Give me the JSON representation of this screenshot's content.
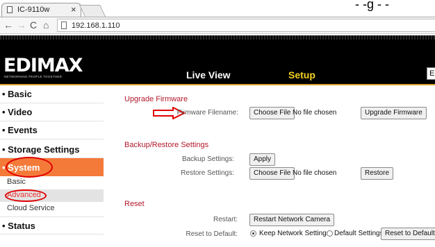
{
  "browser": {
    "tab_title": "IC-9110w",
    "tab_close": "×",
    "url": "192.168.1.110",
    "stray_text": "- -g - -"
  },
  "header": {
    "logo_text": "EDIMAX",
    "logo_tagline": "NETWORKING PEOPLE TOGETHER",
    "nav_live_view": "Live View",
    "nav_setup": "Setup",
    "language_value": "E"
  },
  "sidebar": {
    "basic": "• Basic",
    "video": "• Video",
    "events": "• Events",
    "storage": "• Storage Settings",
    "system": "• System",
    "system_sub": {
      "basic": "Basic",
      "advanced": "Advanced",
      "cloud": "Cloud Service"
    },
    "status": "• Status"
  },
  "upgrade": {
    "title": "Upgrade Firmware",
    "filename_label": "Firmware Filename:",
    "choose_file": "Choose File",
    "no_file": "No file chosen",
    "upgrade_button": "Upgrade Firmware"
  },
  "backup": {
    "title": "Backup/Restore Settings",
    "backup_label": "Backup Settings:",
    "apply_button": "Apply",
    "restore_label": "Restore Settings:",
    "choose_file": "Choose File",
    "no_file": "No file chosen",
    "restore_button": "Restore"
  },
  "reset": {
    "title": "Reset",
    "restart_label": "Restart:",
    "restart_button": "Restart Network Camera",
    "default_label": "Reset to Default:",
    "keep_network_option": "Keep Network Settings",
    "default_settings_option": "Default Settings",
    "reset_button": "Reset to Default"
  },
  "colors": {
    "accent_orange": "#f47a3a",
    "setup_yellow": "#f5d21f",
    "section_red": "#b2182b",
    "annotation_red": "#e00000"
  }
}
